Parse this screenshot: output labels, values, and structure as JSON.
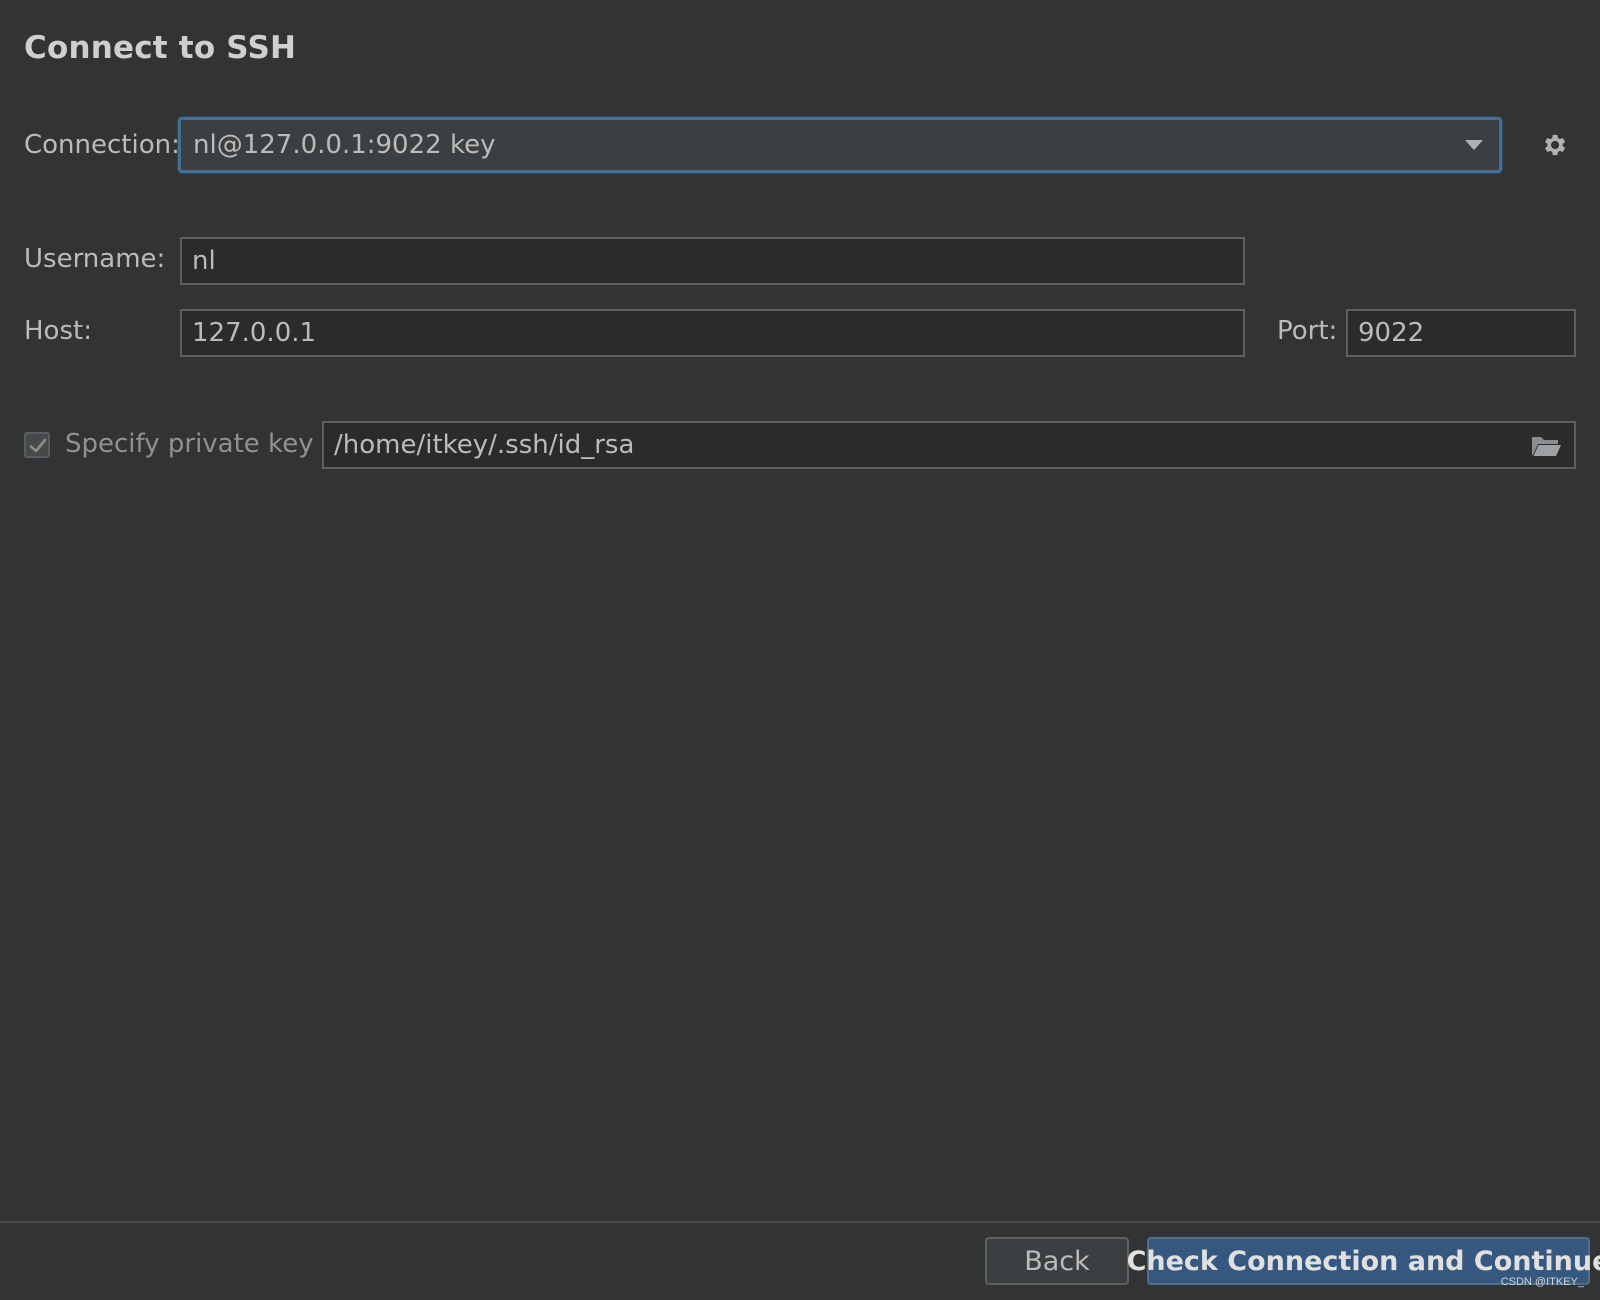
{
  "dialog": {
    "title": "Connect to SSH"
  },
  "connection": {
    "label": "Connection:",
    "value": "nl@127.0.0.1:9022 key"
  },
  "username": {
    "label": "Username:",
    "value": "nl"
  },
  "host": {
    "label": "Host:",
    "value": "127.0.0.1"
  },
  "port": {
    "label": "Port:",
    "value": "9022"
  },
  "private_key": {
    "checkbox_label": "Specify private key",
    "checked": true,
    "path": "/home/itkey/.ssh/id_rsa"
  },
  "footer": {
    "back_label": "Back",
    "primary_label": "Check Connection and Continue"
  },
  "watermark": "CSDN @ITKEY_",
  "icons": {
    "combo_arrow": "chevron-down-icon",
    "settings": "gear-icon",
    "check": "checkmark-icon",
    "browse": "folder-open-icon"
  },
  "colors": {
    "background": "#313335",
    "field_border": "#5e6060",
    "focus_border": "#466d94",
    "primary_button": "#365880"
  }
}
